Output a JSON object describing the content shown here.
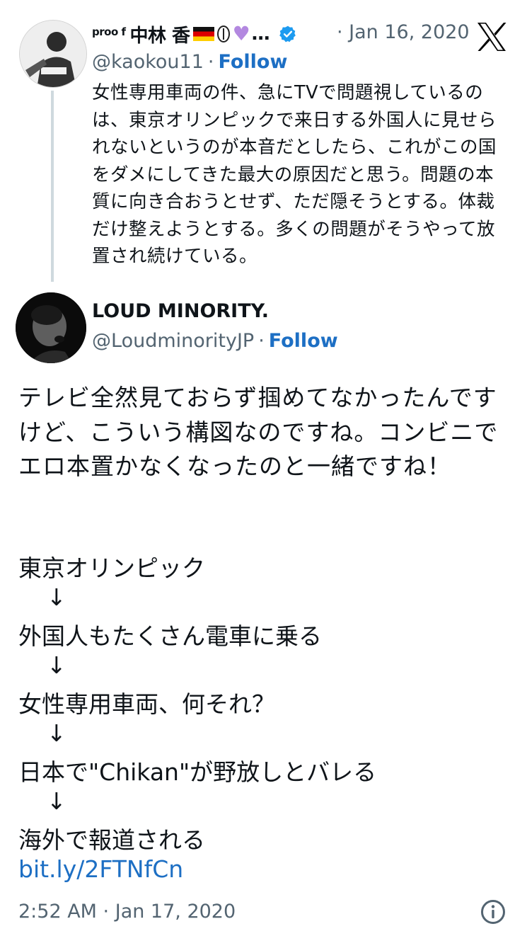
{
  "quoted_tweet": {
    "name_prefix": "proo f",
    "name": "中林 香",
    "name_suffix": "…",
    "handle": "@kaokou11",
    "follow_label": "Follow",
    "date": "· Jan 16, 2020",
    "text": "女性専用車両の件、急にTVで問題視しているのは、東京オリンピックで来日する外国人に見せられないというのが本音だとしたら、これがこの国をダメにしてきた最大の原因だと思う。問題の本質に向き合おうとせず、ただ隠そうとする。体裁だけ整えようとする。多くの問題がそうやって放置され続けている。"
  },
  "main_tweet": {
    "name": "LOUD MINORITY.",
    "handle": "@LoudminorityJP",
    "follow_label": "Follow",
    "text": "テレビ全然見ておらず掴めてなかったんですけど、こういう構図なのですね。コンビニでエロ本置かなくなったのと一緒ですね！",
    "chain": [
      "東京オリンピック",
      "外国人もたくさん電車に乗る",
      "女性専用車両、何それ？",
      "日本で\"Chikan\"が野放しとバレる",
      "海外で報道される"
    ],
    "arrow": "↓",
    "link": "bit.ly/2FTNfCn",
    "timestamp": "2:52 AM · Jan 17, 2020"
  },
  "icons": {
    "verified": "verified-badge-icon",
    "logo": "x-logo-icon",
    "info": "info-icon",
    "flag": "german-flag-emoji",
    "heart": "purple-heart-emoji"
  },
  "colors": {
    "link": "#1d6fc4",
    "secondary_text": "#536471",
    "verified": "#1d9bf0",
    "heart": "#b388e0"
  }
}
